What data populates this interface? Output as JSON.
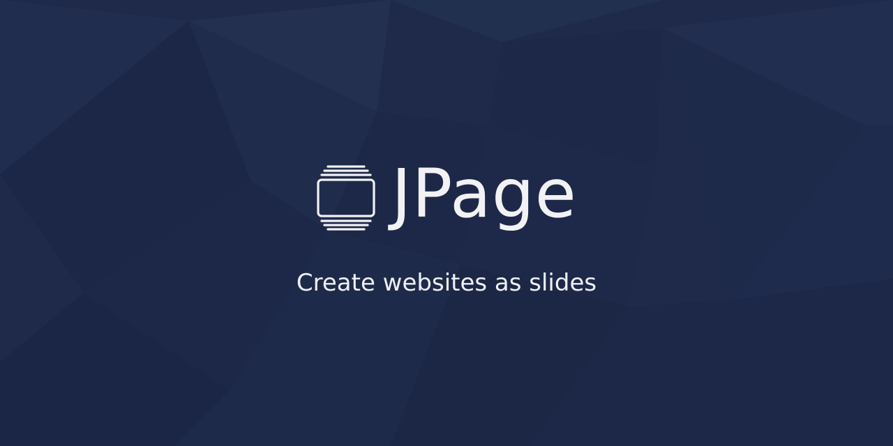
{
  "brand": {
    "name": "JPage",
    "tagline": "Create websites as slides",
    "logo_icon": "slides-stack-icon"
  },
  "colors": {
    "background": "#1f2a4b",
    "text": "#f2f2f4"
  }
}
